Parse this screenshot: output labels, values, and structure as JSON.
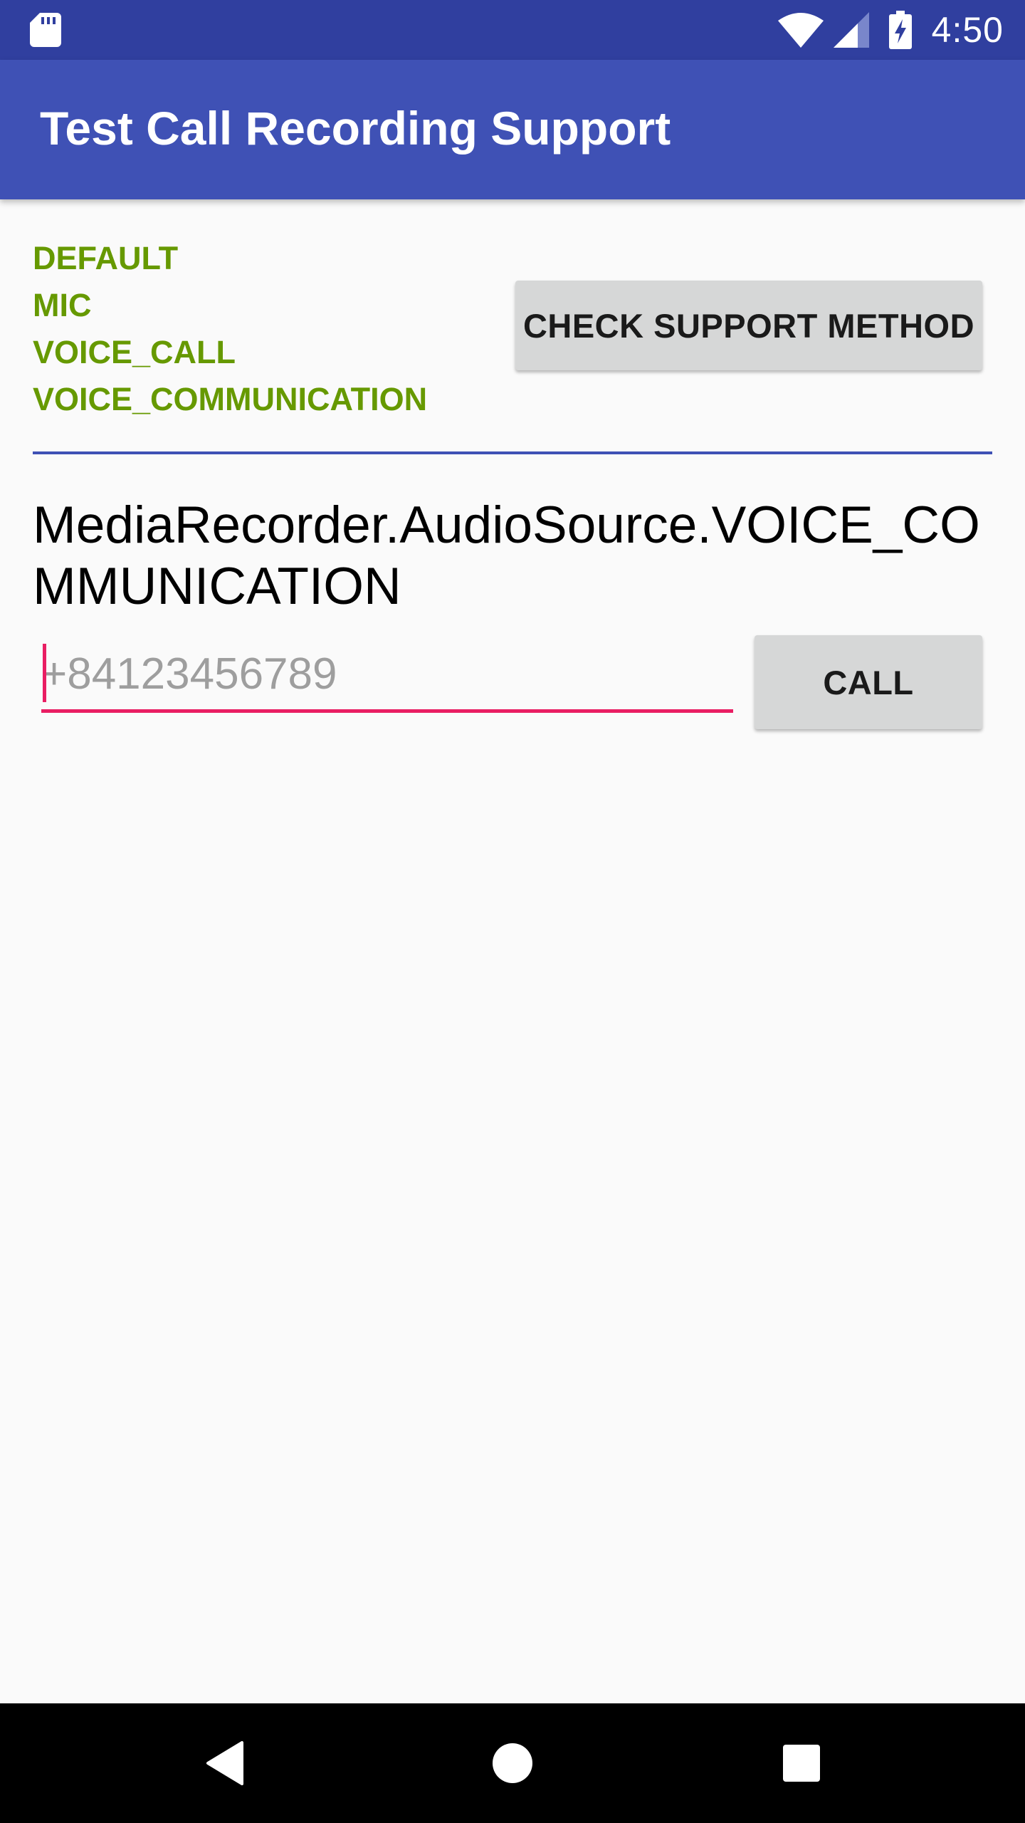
{
  "status_bar": {
    "time": "4:50",
    "background_color": "#303f9f",
    "icons": [
      "sd-card-icon",
      "wifi-icon",
      "cellular-signal-icon",
      "battery-charging-icon"
    ]
  },
  "app_bar": {
    "title": "Test Call Recording Support",
    "background_color": "#3f51b5"
  },
  "methods": {
    "color": "#669900",
    "items": [
      {
        "label": "DEFAULT"
      },
      {
        "label": "MIC"
      },
      {
        "label": "VOICE_CALL"
      },
      {
        "label": "VOICE_COMMUNICATION"
      }
    ]
  },
  "check_button": {
    "label": "CHECK SUPPORT METHOD"
  },
  "result": {
    "text": "MediaRecorder.AudioSource.VOICE_COMMUNICATION"
  },
  "phone": {
    "placeholder": "+84123456789",
    "value": "",
    "accent_color": "#e91e63"
  },
  "call_button": {
    "label": "CALL"
  },
  "nav_bar": {
    "icons": [
      "back-icon",
      "home-icon",
      "recents-icon"
    ]
  }
}
